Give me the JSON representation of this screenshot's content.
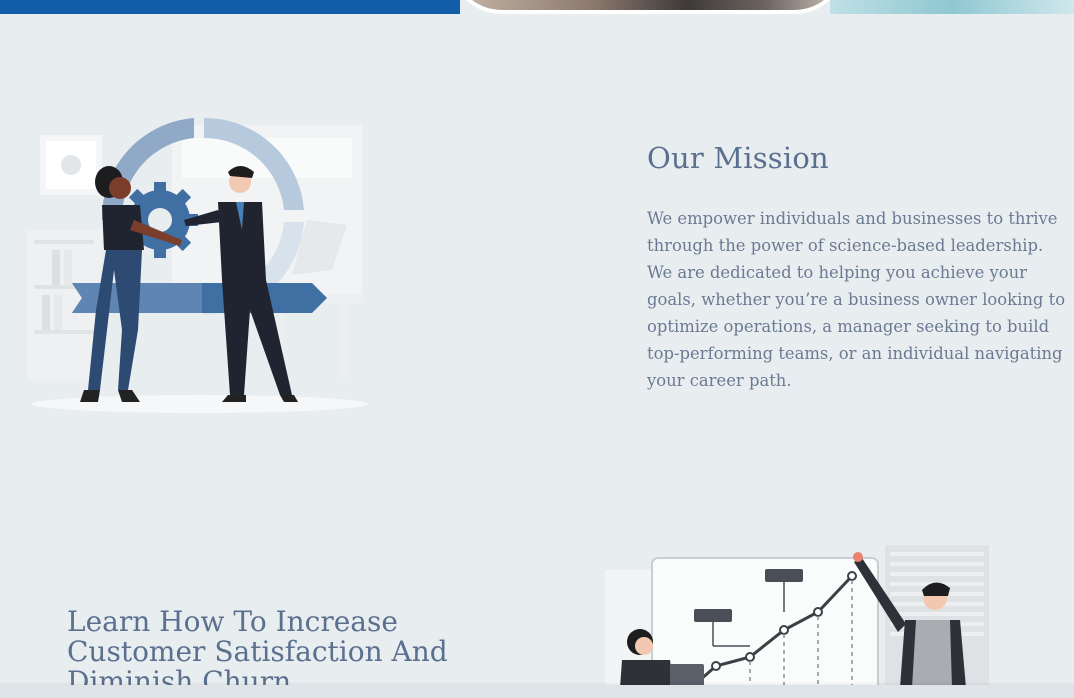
{
  "hero": {
    "strip_colors": {
      "left": "#135eaa",
      "right": "#8fc7d1"
    }
  },
  "mission": {
    "title": "Our Mission",
    "text": "We empower individuals and businesses to thrive through the power of science-based leadership. We are dedicated to helping you achieve your goals, whether you’re a business owner looking to optimize operations, a manager seeking to build top-performing teams, or an individual navigating your career path.",
    "illustration": "teamwork-gear-cycle-illustration"
  },
  "churn": {
    "title": "Learn How To Increase Customer Satisfaction And Diminish Churn",
    "illustration": "growth-chart-presentation-illustration"
  },
  "colors": {
    "heading": "#5b6f8f",
    "body_text": "#6b7a93",
    "background": "#e8edf0",
    "accent_blue": "#3f6fa3"
  }
}
